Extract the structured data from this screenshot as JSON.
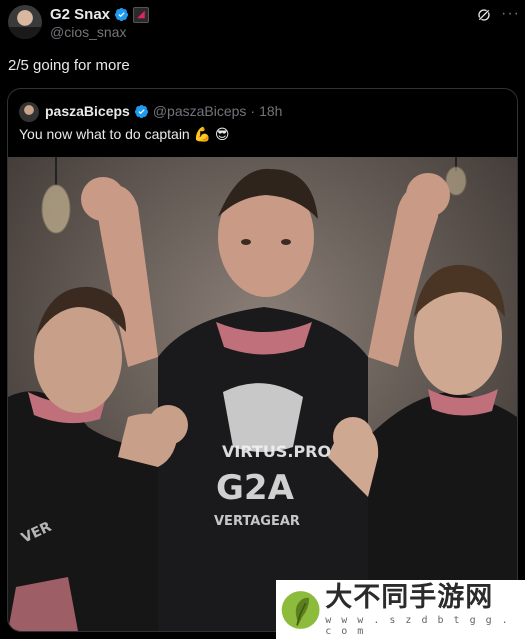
{
  "tweet": {
    "author_name": "G2 Snax",
    "author_handle": "@cios_snax",
    "text": "2/5 going for more",
    "more_label": "···"
  },
  "quoted_tweet": {
    "author_name": "paszaBiceps",
    "author_handle": "@paszaBiceps",
    "separator": "·",
    "time": "18h",
    "text": "You now what to do captain 💪 😎"
  },
  "photo": {
    "jersey_texts": [
      "VIRTUS.PRO",
      "G2A",
      "VERTAGEAR",
      "VER"
    ]
  },
  "watermark": {
    "title": "大不同手游网",
    "url": "w w w . s z d b t g g . c o m"
  },
  "colors": {
    "background": "#000000",
    "text_primary": "#e7e9ea",
    "text_secondary": "#71767b",
    "verified_blue": "#1d9bf0",
    "border": "#2f3336"
  }
}
